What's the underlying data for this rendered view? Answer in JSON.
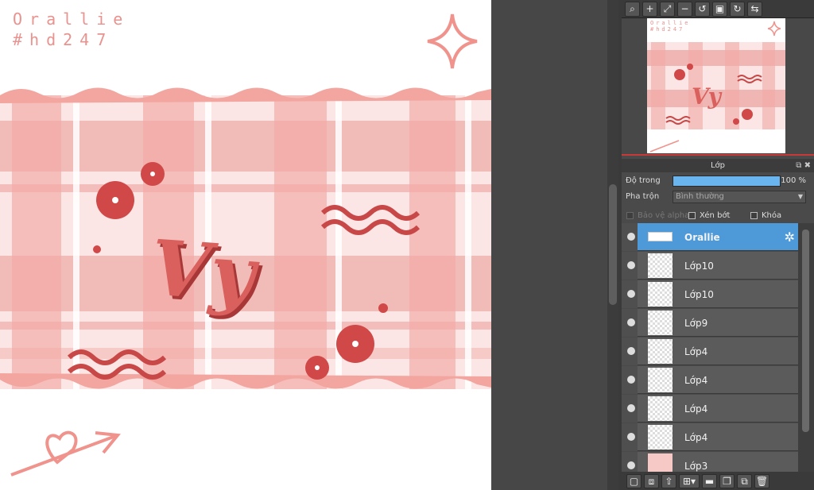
{
  "canvas": {
    "signature_line1": "Orallie",
    "signature_line2": "#hd247",
    "art_text": "Vy",
    "colors": {
      "pink": "#f2b7b4",
      "red": "#d95a5a",
      "dark_red": "#c24545",
      "peach": "#f0a9a2"
    }
  },
  "navigator_toolbar": {
    "buttons": [
      "zoom-fit-icon",
      "zoom-in-icon",
      "fit-screen-icon",
      "zoom-out-icon",
      "rotate-left-icon",
      "fullscreen-icon",
      "rotate-right-icon",
      "flip-icon"
    ]
  },
  "navigator": {
    "signature_line1": "Orallie",
    "signature_line2": "#hd247"
  },
  "layer_panel": {
    "title": "Lớp",
    "opacity_label": "Độ trong",
    "opacity_value": "100 %",
    "opacity_fraction": 1.0,
    "blend_label": "Pha trộn",
    "blend_value": "Bình thường",
    "protect_alpha": "Bảo vệ alpha",
    "clipping": "Xén bớt",
    "lock": "Khóa",
    "layers": [
      {
        "name": "Orallie",
        "selected": true
      },
      {
        "name": "Lớp10"
      },
      {
        "name": "Lớp10"
      },
      {
        "name": "Lớp9"
      },
      {
        "name": "Lớp4"
      },
      {
        "name": "Lớp4"
      },
      {
        "name": "Lớp4"
      },
      {
        "name": "Lớp4"
      },
      {
        "name": "Lớp3"
      }
    ]
  },
  "layer_toolbar": {
    "buttons": [
      "new-layer-icon",
      "new-layer-copy-icon",
      "import-layer-icon",
      "add-layer-menu-icon",
      "folder-icon",
      "duplicate-icon",
      "merge-icon",
      "delete-icon"
    ]
  }
}
